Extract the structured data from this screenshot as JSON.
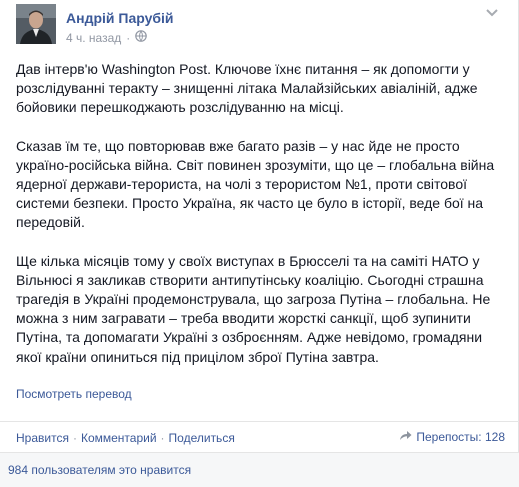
{
  "post": {
    "author": "Андрій Парубій",
    "time": "4 ч. назад",
    "paragraphs": [
      "Дав інтерв'ю Washington Post. Ключове їхнє питання – як допомогти у розслідуванні теракту – знищенні літака Малайзійських авіаліній, адже бойовики перешкоджають розслідуванню на місці.",
      "Сказав їм те, що повторював вже багато разів – у нас йде не просто україно-російська війна. Світ повинен зрозуміти, що це – глобальна війна ядерної держави-терориста, на чолі з терористом №1, проти світової системи безпеки. Просто Україна, як часто це було в історії, веде бої на передовій.",
      "Ще кілька місяців тому у своїх виступах в Брюсселі та на саміті НАТО у Вільнюсі я закликав створити антипутінську коаліцію. Сьогодні страшна трагедія в Україні продемонструвала, що загроза Путіна – глобальна. Не можна з ним загравати – треба вводити жорсткі санкції, щоб зупинити Путіна, та допомагати Україні з озброєнням. Адже невідомо, громадяни якої країни опиниться під прицілом зброї Путіна завтра."
    ],
    "translate": "Посмотреть перевод"
  },
  "actions": {
    "like": "Нравится",
    "comment": "Комментарий",
    "share": "Поделиться",
    "separator": "·",
    "shares_label": "Перепосты: 128"
  },
  "likes": {
    "text": "984 пользователям это нравится"
  },
  "icons": {
    "audience": "globe-icon",
    "options": "chevron-down-icon",
    "shares": "share-icon"
  },
  "colors": {
    "link": "#3b5998",
    "meta": "#9197a3",
    "text": "#141823"
  }
}
